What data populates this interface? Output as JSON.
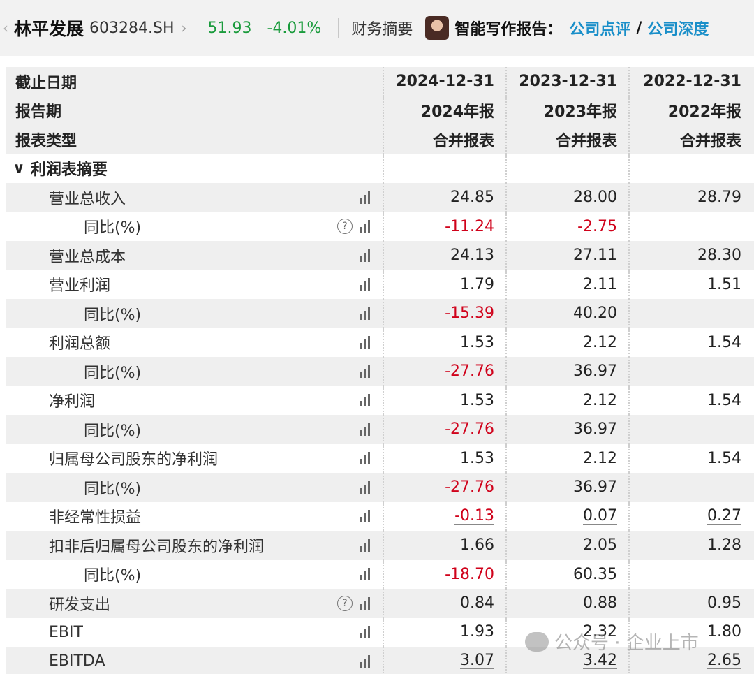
{
  "header": {
    "stock_name": "林平发展",
    "stock_code": "603284.SH",
    "price": "51.93",
    "change_pct": "-4.01%",
    "summary_label": "财务摘要",
    "report_label": "智能写作报告：",
    "link_review": "公司点评",
    "separator": "/",
    "link_depth": "公司深度"
  },
  "table": {
    "head_rows": [
      {
        "label": "截止日期",
        "values": [
          "2024-12-31",
          "2023-12-31",
          "2022-12-31"
        ]
      },
      {
        "label": "报告期",
        "values": [
          "2024年报",
          "2023年报",
          "2022年报"
        ]
      },
      {
        "label": "报表类型",
        "values": [
          "合并报表",
          "合并报表",
          "合并报表"
        ]
      }
    ],
    "section_label": "利润表摘要",
    "rows": [
      {
        "label": "营业总收入",
        "values": [
          "24.85",
          "28.00",
          "28.79"
        ]
      },
      {
        "label": "同比(%)",
        "values": [
          "-11.24",
          "-2.75",
          ""
        ]
      },
      {
        "label": "营业总成本",
        "values": [
          "24.13",
          "27.11",
          "28.30"
        ]
      },
      {
        "label": "营业利润",
        "values": [
          "1.79",
          "2.11",
          "1.51"
        ]
      },
      {
        "label": "同比(%)",
        "values": [
          "-15.39",
          "40.20",
          ""
        ]
      },
      {
        "label": "利润总额",
        "values": [
          "1.53",
          "2.12",
          "1.54"
        ]
      },
      {
        "label": "同比(%)",
        "values": [
          "-27.76",
          "36.97",
          ""
        ]
      },
      {
        "label": "净利润",
        "values": [
          "1.53",
          "2.12",
          "1.54"
        ]
      },
      {
        "label": "同比(%)",
        "values": [
          "-27.76",
          "36.97",
          ""
        ]
      },
      {
        "label": "归属母公司股东的净利润",
        "values": [
          "1.53",
          "2.12",
          "1.54"
        ]
      },
      {
        "label": "同比(%)",
        "values": [
          "-27.76",
          "36.97",
          ""
        ]
      },
      {
        "label": "非经常性损益",
        "values": [
          "-0.13",
          "0.07",
          "0.27"
        ]
      },
      {
        "label": "扣非后归属母公司股东的净利润",
        "values": [
          "1.66",
          "2.05",
          "1.28"
        ]
      },
      {
        "label": "同比(%)",
        "values": [
          "-18.70",
          "60.35",
          ""
        ]
      },
      {
        "label": "研发支出",
        "values": [
          "0.84",
          "0.88",
          "0.95"
        ]
      },
      {
        "label": "EBIT",
        "values": [
          "1.93",
          "2.32",
          "1.80"
        ]
      },
      {
        "label": "EBITDA",
        "values": [
          "3.07",
          "3.42",
          "2.65"
        ]
      }
    ]
  },
  "watermark": {
    "text": "公众号 · 企业上市"
  },
  "colors": {
    "up": "#d0021b",
    "down": "#1a9b3c",
    "link": "#1a8fc9"
  },
  "icons": [
    "chevron-left-icon",
    "chevron-right-icon",
    "avatar",
    "help-icon",
    "bar-chart-icon",
    "chevron-down-icon",
    "wechat-icon"
  ]
}
